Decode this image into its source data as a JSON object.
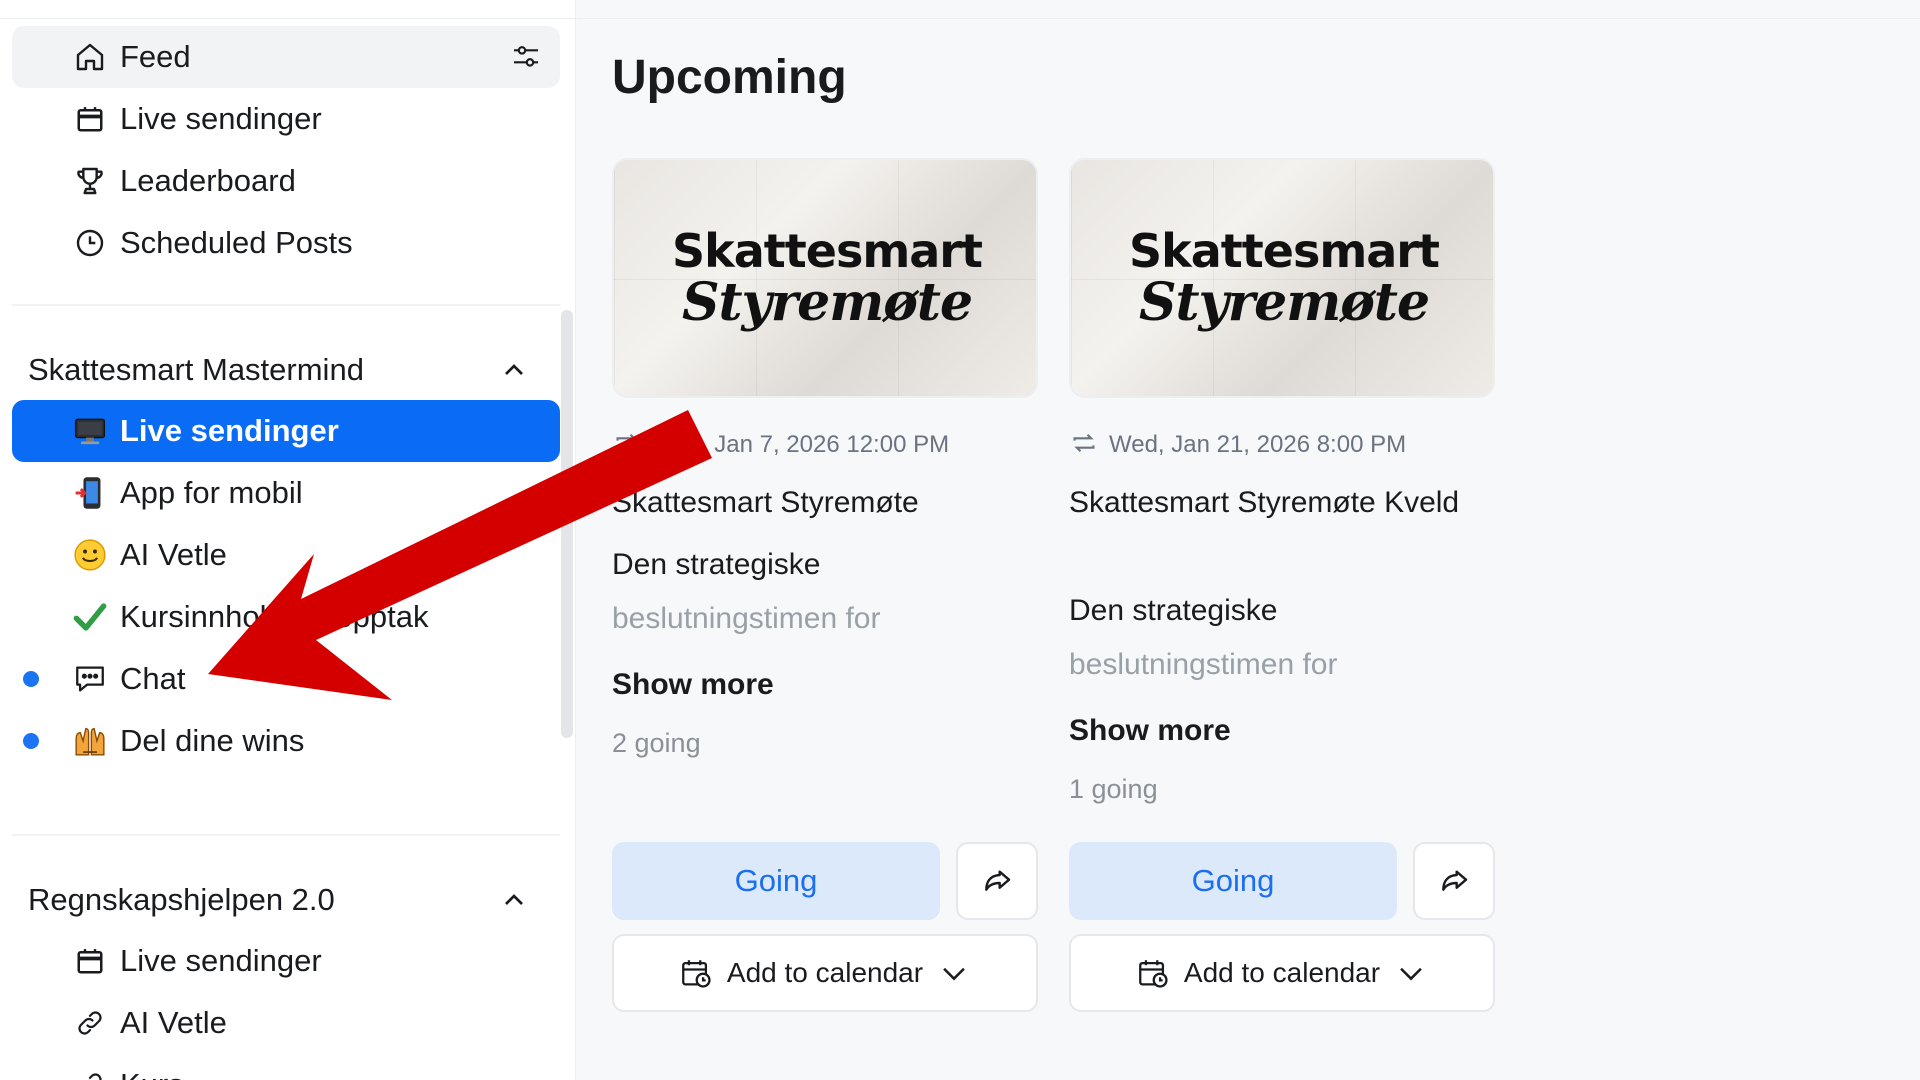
{
  "sidebar": {
    "top_items": [
      {
        "label": "Feed",
        "icon": "home-icon"
      },
      {
        "label": "Live sendinger",
        "icon": "calendar-icon"
      },
      {
        "label": "Leaderboard",
        "icon": "trophy-icon"
      },
      {
        "label": "Scheduled Posts",
        "icon": "clock-icon"
      }
    ],
    "groups": [
      {
        "title": "Skattesmart Mastermind",
        "items": [
          {
            "label": "Live sendinger",
            "emoji": "🖥️",
            "active": true
          },
          {
            "label": "App for mobil",
            "emoji": "📲"
          },
          {
            "label": "AI Vetle",
            "emoji": "🙂"
          },
          {
            "label": "Kursinnhold og opptak",
            "emoji": "✔️"
          },
          {
            "label": "Chat",
            "icon": "chat-icon",
            "unread": true
          },
          {
            "label": "Del dine wins",
            "emoji": "🙌",
            "unread": true
          }
        ]
      },
      {
        "title": "Regnskapshjelpen 2.0",
        "items": [
          {
            "label": "Live sendinger",
            "icon": "calendar-icon"
          },
          {
            "label": "AI Vetle",
            "icon": "link-icon"
          },
          {
            "label": "Kurs",
            "icon": "link-icon"
          }
        ]
      }
    ]
  },
  "main": {
    "heading": "Upcoming",
    "events": [
      {
        "thumb_line1": "Skattesmart",
        "thumb_line2": "Styremøte",
        "date": "Wed, Jan 7, 2026 12:00 PM",
        "title": "Skattesmart Styremøte",
        "desc_line1": "Den strategiske",
        "desc_line2": "beslutningstimen for",
        "show_more": "Show more",
        "going_count": "2 going",
        "going_button": "Going",
        "calendar_button": "Add to calendar"
      },
      {
        "thumb_line1": "Skattesmart",
        "thumb_line2": "Styremøte",
        "date": "Wed, Jan 21, 2026 8:00 PM",
        "title": "Skattesmart Styremøte Kveld",
        "desc_line1": "Den strategiske",
        "desc_line2": "beslutningstimen for",
        "show_more": "Show more",
        "going_count": "1 going",
        "going_button": "Going",
        "calendar_button": "Add to calendar"
      }
    ]
  },
  "colors": {
    "accent": "#0a6cf5",
    "going_bg": "#dce9fb",
    "annotation_arrow": "#d40000",
    "unread_dot": "#1b74f2"
  }
}
